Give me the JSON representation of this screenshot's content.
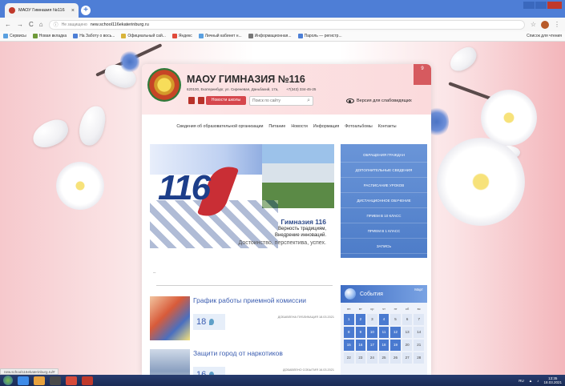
{
  "browser": {
    "tab_title": "МАОУ Гимназия №116",
    "tab_close": "×",
    "new_tab": "+",
    "secure_text": "Не защищено",
    "url": "new.school116ekaterinburg.ru",
    "bookmarks": [
      {
        "label": "Сервисы",
        "color": "#5aa0e0"
      },
      {
        "label": "Новая вкладка",
        "color": "#6f9a3a"
      },
      {
        "label": "На Заботу о вось...",
        "color": "#4d7fd6"
      },
      {
        "label": "Официальный сай...",
        "color": "#d9b43a"
      },
      {
        "label": "Яндекс",
        "color": "#e04a3a"
      },
      {
        "label": "Личный кабинет н...",
        "color": "#5aa0e0"
      },
      {
        "label": "Информационная...",
        "color": "#777777"
      },
      {
        "label": "Пароль — регистр...",
        "color": "#4d7fd6"
      }
    ],
    "bookmarks_right": "Список для чтения"
  },
  "site": {
    "name": "МАОУ ГИМНАЗИЯ №116",
    "address": "620100, Екатеринбург, ул. Сиреневая, Даньбахий, 17а,",
    "phone": "+7(343) 334-45-25",
    "news_button": "Новости школы",
    "search_placeholder": "Поиск по сайту",
    "visually_impaired": "Версия для слабовидящих",
    "corner_tag": "9",
    "menu": [
      "Сведения об образовательной организации",
      "Питание",
      "Новости",
      "Информация",
      "Фотоальбомы",
      "Контакты"
    ],
    "banner": {
      "number": "116",
      "title": "Гимназия 116",
      "line1": "Верность традициям,",
      "line2": "Внедрение инноваций.",
      "line3": "Достоинство, перспектива, успех."
    },
    "side_menu": [
      "ОБРАЩЕНИЯ ГРАЖДАН",
      "ДОПОЛНИТЕЛЬНЫЕ СВЕДЕНИЯ",
      "РАСПИСАНИЕ УРОКОВ",
      "ДИСТАНЦИОННОЕ ОБУЧЕНИЕ",
      "ПРИЕМ В 10 КЛАСС",
      "ПРИЕМ В 1 КЛАСС",
      "ЗАПИСЬ"
    ],
    "news": [
      {
        "title": "График работы приемной комиссии",
        "day": "18",
        "meta": "ДОБАВЛЕНА ПУБЛИКАЦИЯ 18.03.2021"
      },
      {
        "title": "Защити город от наркотиков",
        "day": "16",
        "meta": "ДОБАВЛЕНО СОБЫТИЯ 16.03.2021"
      }
    ],
    "calendar": {
      "title": "События",
      "month": "Март",
      "dow": [
        "пн",
        "вт",
        "ср",
        "чт",
        "пт",
        "сб",
        "вс"
      ],
      "days": [
        "1",
        "2",
        "3",
        "4",
        "5",
        "6",
        "7",
        "8",
        "9",
        "10",
        "11",
        "12",
        "13",
        "14",
        "15",
        "16",
        "17",
        "18",
        "19",
        "20",
        "21",
        "22",
        "23",
        "24",
        "25",
        "26",
        "27",
        "28"
      ],
      "event_days": [
        "1",
        "2",
        "4",
        "8",
        "9",
        "10",
        "11",
        "12",
        "15",
        "16",
        "17",
        "18",
        "19"
      ]
    }
  },
  "status_url": "new.school116ekaterinburg.ru/#",
  "taskbar": {
    "lang": "RU",
    "time": "13:35",
    "date": "18.03.2021"
  }
}
